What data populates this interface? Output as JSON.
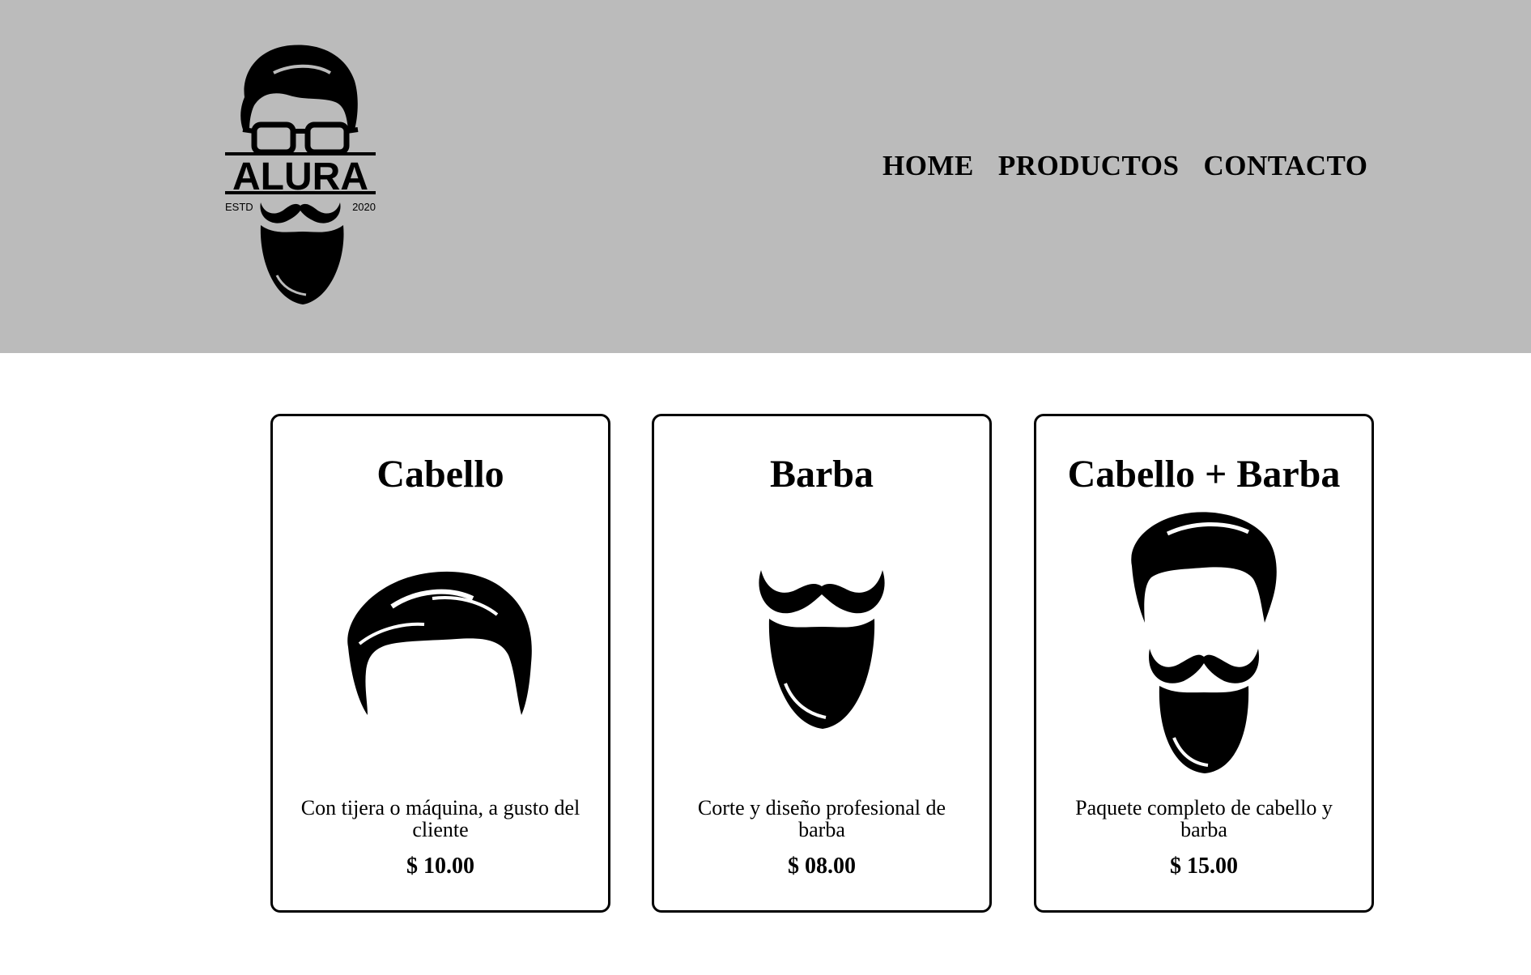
{
  "header": {
    "logo": {
      "name": "ALURA",
      "estd": "ESTD",
      "year": "2020"
    },
    "nav": [
      {
        "label": "HOME"
      },
      {
        "label": "PRODUCTOS"
      },
      {
        "label": "CONTACTO"
      }
    ],
    "background": "#bbbbbb"
  },
  "products": [
    {
      "title": "Cabello",
      "description": "Con tijera o máquina, a gusto del cliente",
      "price": "$ 10.00",
      "icon": "hair-icon"
    },
    {
      "title": "Barba",
      "description": "Corte y diseño profesional de barba",
      "price": "$ 08.00",
      "icon": "beard-icon"
    },
    {
      "title": "Cabello + Barba",
      "description": "Paquete completo de cabello y barba",
      "price": "$ 15.00",
      "icon": "hair-and-beard-icon"
    }
  ]
}
